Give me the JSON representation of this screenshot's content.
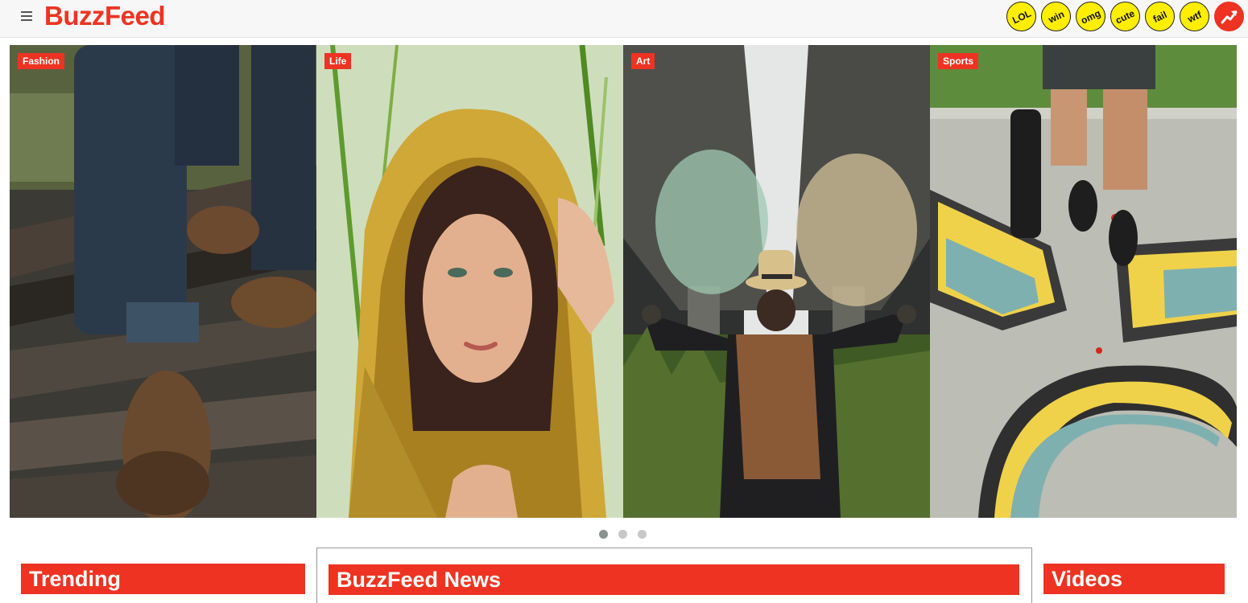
{
  "header": {
    "logo": "BuzzFeed",
    "menu_icon": "hamburger-menu-icon",
    "badges": [
      {
        "label": "LOL"
      },
      {
        "label": "win"
      },
      {
        "label": "omg"
      },
      {
        "label": "cute"
      },
      {
        "label": "fail"
      },
      {
        "label": "wtf"
      },
      {
        "label": "",
        "icon": "trending-arrow-icon"
      }
    ],
    "colors": {
      "brand": "#ee3322",
      "badge": "#ffee00"
    }
  },
  "carousel": {
    "cards": [
      {
        "tag": "Fashion",
        "image": "legs-boots-railroad-photo"
      },
      {
        "tag": "Life",
        "image": "woman-yellow-scarf-portrait-photo"
      },
      {
        "tag": "Art",
        "image": "man-smoke-bombs-under-bridge-photo"
      },
      {
        "tag": "Sports",
        "image": "skateboarder-graffiti-ramp-photo"
      }
    ],
    "dots": [
      {
        "active": true
      },
      {
        "active": false
      },
      {
        "active": false
      }
    ]
  },
  "sections": {
    "trending": "Trending",
    "news": "BuzzFeed News",
    "videos": "Videos"
  }
}
